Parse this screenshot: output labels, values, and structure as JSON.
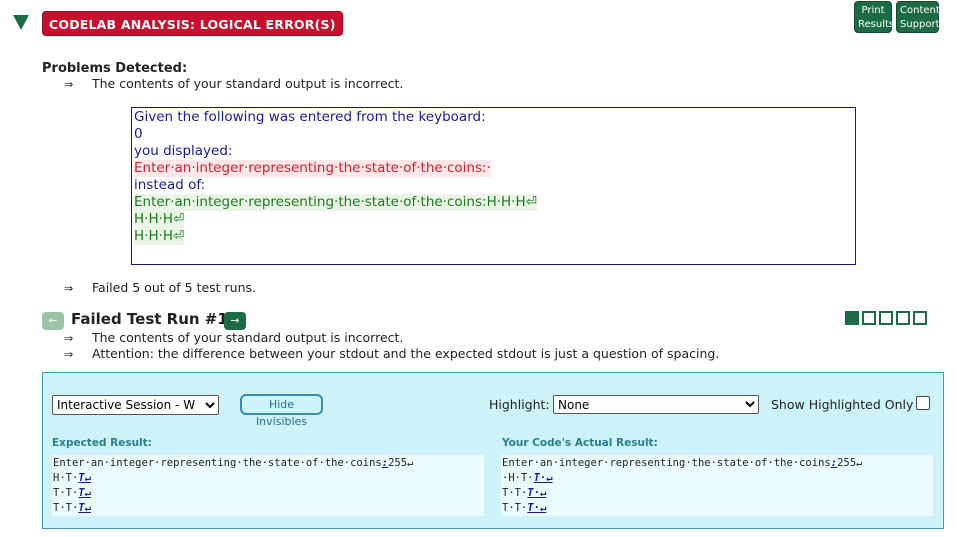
{
  "header": {
    "badge": "CODELAB ANALYSIS: LOGICAL ERROR(S)",
    "print_results": [
      "Print",
      "Results"
    ],
    "content_support": [
      "Content",
      "Support"
    ]
  },
  "problems": {
    "title": "Problems Detected:",
    "arrow": "⇒",
    "line1": "The contents of your standard output is incorrect.",
    "failed_runs": "Failed 5 out of 5 test runs."
  },
  "code_box": {
    "given": "Given the following was entered from the keyboard:",
    "input": "0",
    "you_displayed": "you displayed:",
    "displayed": "Enter·an·integer·representing·the·state·of·the·coins:·",
    "instead_of": "instead of:",
    "expected_1": "Enter·an·integer·representing·the·state·of·the·coins:H·H·H⏎",
    "expected_2": "H·H·H⏎",
    "expected_3": "H·H·H⏎"
  },
  "test_run": {
    "prev_icon": "←",
    "next_icon": "→",
    "title": "Failed Test Run #1",
    "line1": "The contents of your standard output is incorrect.",
    "line2": "Attention: the difference between your stdout and the expected stdout is just a question of spacing.",
    "total_runs": 5,
    "current_run": 1
  },
  "compare": {
    "session_value": "Interactive Session - W",
    "hide_invisibles": "Hide Invisibles",
    "highlight_label": "Highlight:",
    "highlight_value": "None",
    "show_highlighted_label": "Show Highlighted Only",
    "expected_title": "Expected Result:",
    "actual_title": "Your Code's Actual Result:",
    "expected_lines": [
      [
        "Enter·an·integer·representing·the·state·of·the·coins",
        ":",
        "255↵"
      ],
      [
        "H·T·",
        "T↵",
        ""
      ],
      [
        "T·T·",
        "T↵",
        ""
      ],
      [
        "T·T·",
        "T↵",
        ""
      ]
    ],
    "actual_lines": [
      [
        "Enter·an·integer·representing·the·state·of·the·coins",
        ":",
        "255↵"
      ],
      [
        "·H·T·",
        "T·↵",
        ""
      ],
      [
        "T·T·",
        "T·↵",
        ""
      ],
      [
        "T·T·",
        "T·↵",
        ""
      ]
    ]
  },
  "colors": {
    "badge_red": "#c8102e",
    "brand_green": "#1d6b45",
    "panel_cyan": "#cdf2f7"
  }
}
